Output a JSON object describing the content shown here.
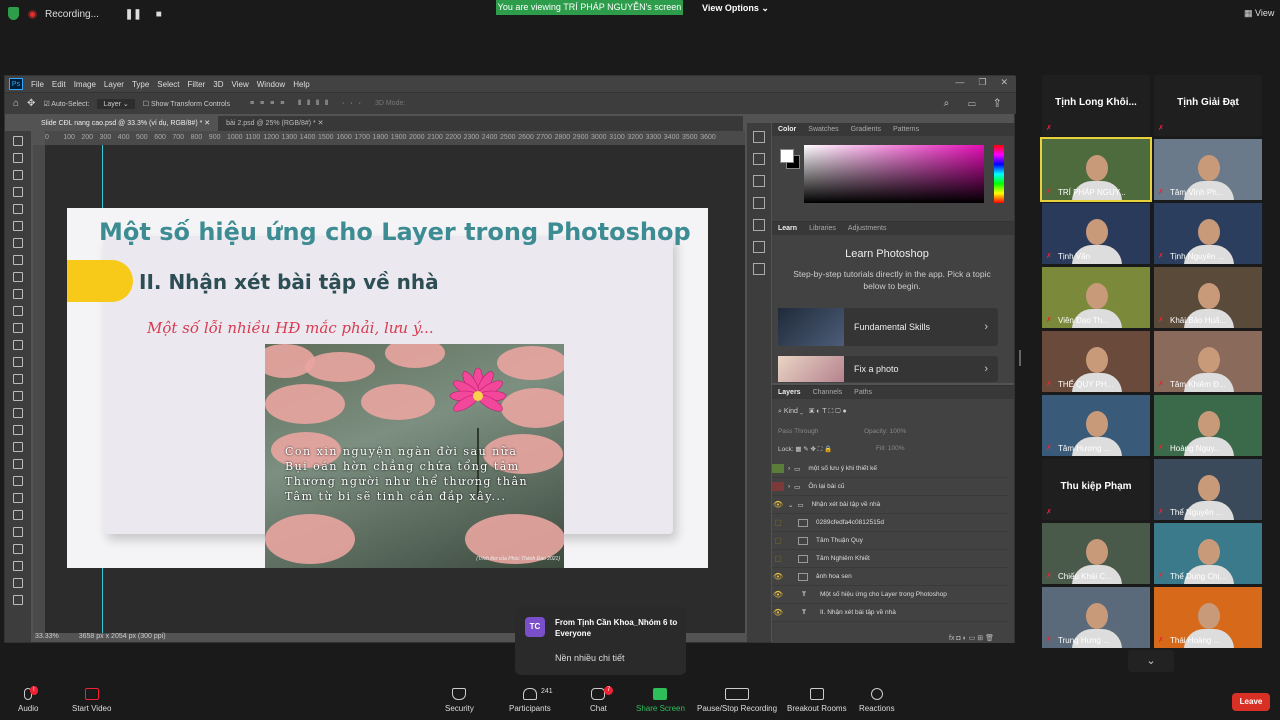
{
  "zoom": {
    "recording_label": "Recording...",
    "viewing_banner": "You are viewing TRÍ PHÁP NGUYỄN's screen",
    "view_options": "View Options",
    "view_label": "View",
    "toolbar": {
      "audio": "Audio",
      "start_video": "Start Video",
      "security": "Security",
      "participants": "Participants",
      "participants_count": "241",
      "chat": "Chat",
      "chat_badge": "7",
      "share_screen": "Share Screen",
      "pause_recording": "Pause/Stop Recording",
      "breakout": "Breakout Rooms",
      "reactions": "Reactions",
      "leave": "Leave"
    },
    "notification": {
      "avatar": "TC",
      "from": "From Tịnh Cần Khoa_Nhóm 6 to Everyone",
      "message": "Nền nhiều chi tiết"
    },
    "gallery": [
      {
        "name": "Tịnh Long Khôi...",
        "type": "namecard"
      },
      {
        "name": "Tịnh Giải Đạt",
        "type": "namecard"
      },
      {
        "name": "TRÍ PHÁP NGUY...",
        "type": "video",
        "highlight": true
      },
      {
        "name": "Tâm Vĩnh Ph...",
        "type": "video"
      },
      {
        "name": "Tịnh Văn",
        "type": "video"
      },
      {
        "name": "Tịnh Nguyên ...",
        "type": "video"
      },
      {
        "name": "Viên Đạo Th...",
        "type": "video"
      },
      {
        "name": "Khải Bảo Huấ...",
        "type": "video"
      },
      {
        "name": "THẾ QUY PH...",
        "type": "video"
      },
      {
        "name": "Tâm Khiêm Đ...",
        "type": "video"
      },
      {
        "name": "Tâm Hương ...",
        "type": "video"
      },
      {
        "name": "Hoàng Nguy...",
        "type": "video"
      },
      {
        "name": "Thu kiệp Phạm",
        "type": "namecard"
      },
      {
        "name": "Thể Nguyên ...",
        "type": "video"
      },
      {
        "name": "Chiếu Khải C...",
        "type": "video"
      },
      {
        "name": "Thể Dung Chị...",
        "type": "video"
      },
      {
        "name": "Trung Hưng ...",
        "type": "video"
      },
      {
        "name": "Thái Hoàng ...",
        "type": "video"
      }
    ]
  },
  "photoshop": {
    "menu": [
      "File",
      "Edit",
      "Image",
      "Layer",
      "Type",
      "Select",
      "Filter",
      "3D",
      "View",
      "Window",
      "Help"
    ],
    "options": {
      "auto_select": "Auto-Select:",
      "layer": "Layer",
      "transform": "Show Transform Controls",
      "mode3d": "3D Mode:"
    },
    "tabs": [
      "Slide CĐL nang cao.psd @ 33.3% (ví dụ, RGB/8#) *",
      "bài 2.psd @ 25% (RGB/8#) *"
    ],
    "ruler_ticks": [
      "0",
      "100",
      "200",
      "300",
      "400",
      "500",
      "600",
      "700",
      "800",
      "900",
      "1000",
      "1100",
      "1200",
      "1300",
      "1400",
      "1500",
      "1600",
      "1700",
      "1800",
      "1900",
      "2000",
      "2100",
      "2200",
      "2300",
      "2400",
      "2500",
      "2600",
      "2700",
      "2800",
      "2900",
      "3000",
      "3100",
      "3200",
      "3300",
      "3400",
      "3500",
      "3600"
    ],
    "status": {
      "zoom": "33.33%",
      "doc": "3658 px x 2054 px (300 ppi)"
    },
    "slide": {
      "title": "Một số hiệu ứng cho Layer trong Photoshop",
      "subtitle": "II. Nhận xét bài tập về nhà",
      "note": "Một số lỗi nhiều HĐ mắc phải, lưu ý...",
      "poem": [
        "Con xin nguyện ngàn đời sau nữa",
        "Bụi oán hờn chẳng chứa tổng tâm",
        "Thương người như thể thương thân",
        "Tâm từ bi sẽ tinh cần đắp xây..."
      ],
      "poem_source": "(Trích thơ của Phúc Thành Đạo 2021)"
    },
    "color_panel": {
      "tabs": [
        "Color",
        "Swatches",
        "Gradients",
        "Patterns"
      ]
    },
    "learn_panel": {
      "tabs": [
        "Learn",
        "Libraries",
        "Adjustments"
      ],
      "heading": "Learn Photoshop",
      "desc": "Step-by-step tutorials directly in the app. Pick a topic below to begin.",
      "cards": [
        "Fundamental Skills",
        "Fix a photo"
      ]
    },
    "layers_panel": {
      "tabs": [
        "Layers",
        "Channels",
        "Paths"
      ],
      "kind": "Kind",
      "blend": "Pass Through",
      "opacity": "Opacity: 100%",
      "lock": "Lock:",
      "fill": "Fill: 100%",
      "layers": [
        {
          "name": "một số lưu ý khi thiết kế",
          "kind": "group"
        },
        {
          "name": "Ôn lại bài cũ",
          "kind": "group"
        },
        {
          "name": "Nhận xét bài tập về nhà",
          "kind": "group-open"
        },
        {
          "name": "0289cfedfa4c0812515d",
          "kind": "image"
        },
        {
          "name": "Tâm Thuận Quy",
          "kind": "image"
        },
        {
          "name": "Tâm Nghiêm Khiết",
          "kind": "image"
        },
        {
          "name": "ảnh hoa sen",
          "kind": "image"
        },
        {
          "name": "Một số hiệu ứng cho Layer trong Photoshop",
          "kind": "text"
        },
        {
          "name": "II. Nhận xét bài tập về nhà",
          "kind": "text"
        }
      ]
    }
  }
}
